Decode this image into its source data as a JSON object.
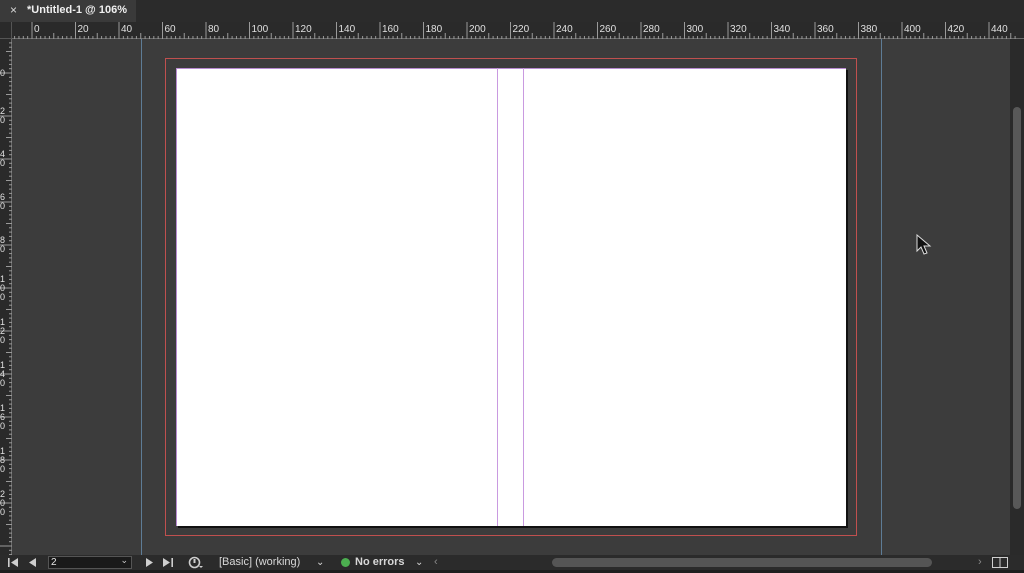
{
  "tab": {
    "close_icon": "×",
    "title": "*Untitled-1 @ 106%"
  },
  "rulers": {
    "horizontal": [
      "0",
      "20",
      "40",
      "60",
      "80",
      "100",
      "120",
      "140",
      "160",
      "180",
      "200",
      "220",
      "240",
      "260",
      "280",
      "300",
      "320",
      "340",
      "360",
      "380",
      "400",
      "420",
      "440"
    ],
    "vertical": [
      "0",
      "20",
      "40",
      "60",
      "80",
      "100",
      "120",
      "140",
      "160",
      "180",
      "200"
    ]
  },
  "status": {
    "first_page_icon": "first-page-icon",
    "prev_page_icon": "prev-page-icon",
    "page_number": "2",
    "next_page_icon": "next-page-icon",
    "last_page_icon": "last-page-icon",
    "preflight_profile": "[Basic] (working)",
    "errors_label": "No errors"
  },
  "colors": {
    "bleed": "#c0504f",
    "margin": "#c99ae0",
    "guide": "#5e7c96",
    "status_ok": "#4caf50"
  }
}
